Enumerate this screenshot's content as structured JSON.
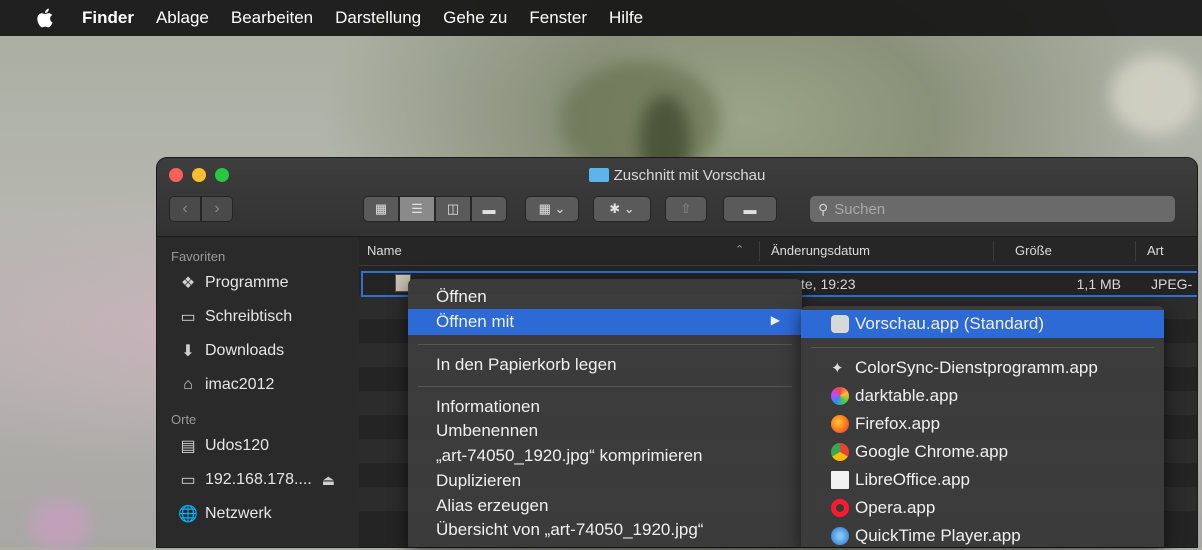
{
  "menubar": {
    "app": "Finder",
    "items": [
      "Ablage",
      "Bearbeiten",
      "Darstellung",
      "Gehe zu",
      "Fenster",
      "Hilfe"
    ]
  },
  "window": {
    "title": "Zuschnitt mit Vorschau",
    "search_placeholder": "Suchen"
  },
  "sidebar": {
    "favorites_heading": "Favoriten",
    "favorites": [
      {
        "label": "Programme",
        "icon": "apps-icon"
      },
      {
        "label": "Schreibtisch",
        "icon": "desktop-icon"
      },
      {
        "label": "Downloads",
        "icon": "downloads-icon"
      },
      {
        "label": "imac2012",
        "icon": "home-icon"
      }
    ],
    "places_heading": "Orte",
    "places": [
      {
        "label": "Udos120",
        "icon": "disk-icon"
      },
      {
        "label": "192.168.178....",
        "icon": "display-icon"
      },
      {
        "label": "Netzwerk",
        "icon": "network-icon"
      }
    ]
  },
  "columns": {
    "name": "Name",
    "date": "Änderungsdatum",
    "size": "Größe",
    "kind": "Art"
  },
  "file": {
    "date": "te, 19:23",
    "size": "1,1 MB",
    "kind": "JPEG-"
  },
  "context_menu": {
    "open": "Öffnen",
    "open_with": "Öffnen mit",
    "trash": "In den Papierkorb legen",
    "info": "Informationen",
    "rename": "Umbenennen",
    "compress": "„art-74050_1920.jpg“ komprimieren",
    "duplicate": "Duplizieren",
    "alias": "Alias erzeugen",
    "quicklook": "Übersicht von „art-74050_1920.jpg“"
  },
  "submenu": {
    "default": "Vorschau.app (Standard)",
    "apps": [
      {
        "label": "ColorSync-Dienstprogramm.app",
        "icon": "colorsync-icon"
      },
      {
        "label": "darktable.app",
        "icon": "darktable-icon"
      },
      {
        "label": "Firefox.app",
        "icon": "firefox-icon"
      },
      {
        "label": "Google Chrome.app",
        "icon": "chrome-icon"
      },
      {
        "label": "LibreOffice.app",
        "icon": "libreoffice-icon"
      },
      {
        "label": "Opera.app",
        "icon": "opera-icon"
      },
      {
        "label": "QuickTime Player.app",
        "icon": "quicktime-icon"
      }
    ]
  },
  "colors": {
    "highlight": "#2d6ad6",
    "selection_border": "#2f6fd6"
  }
}
